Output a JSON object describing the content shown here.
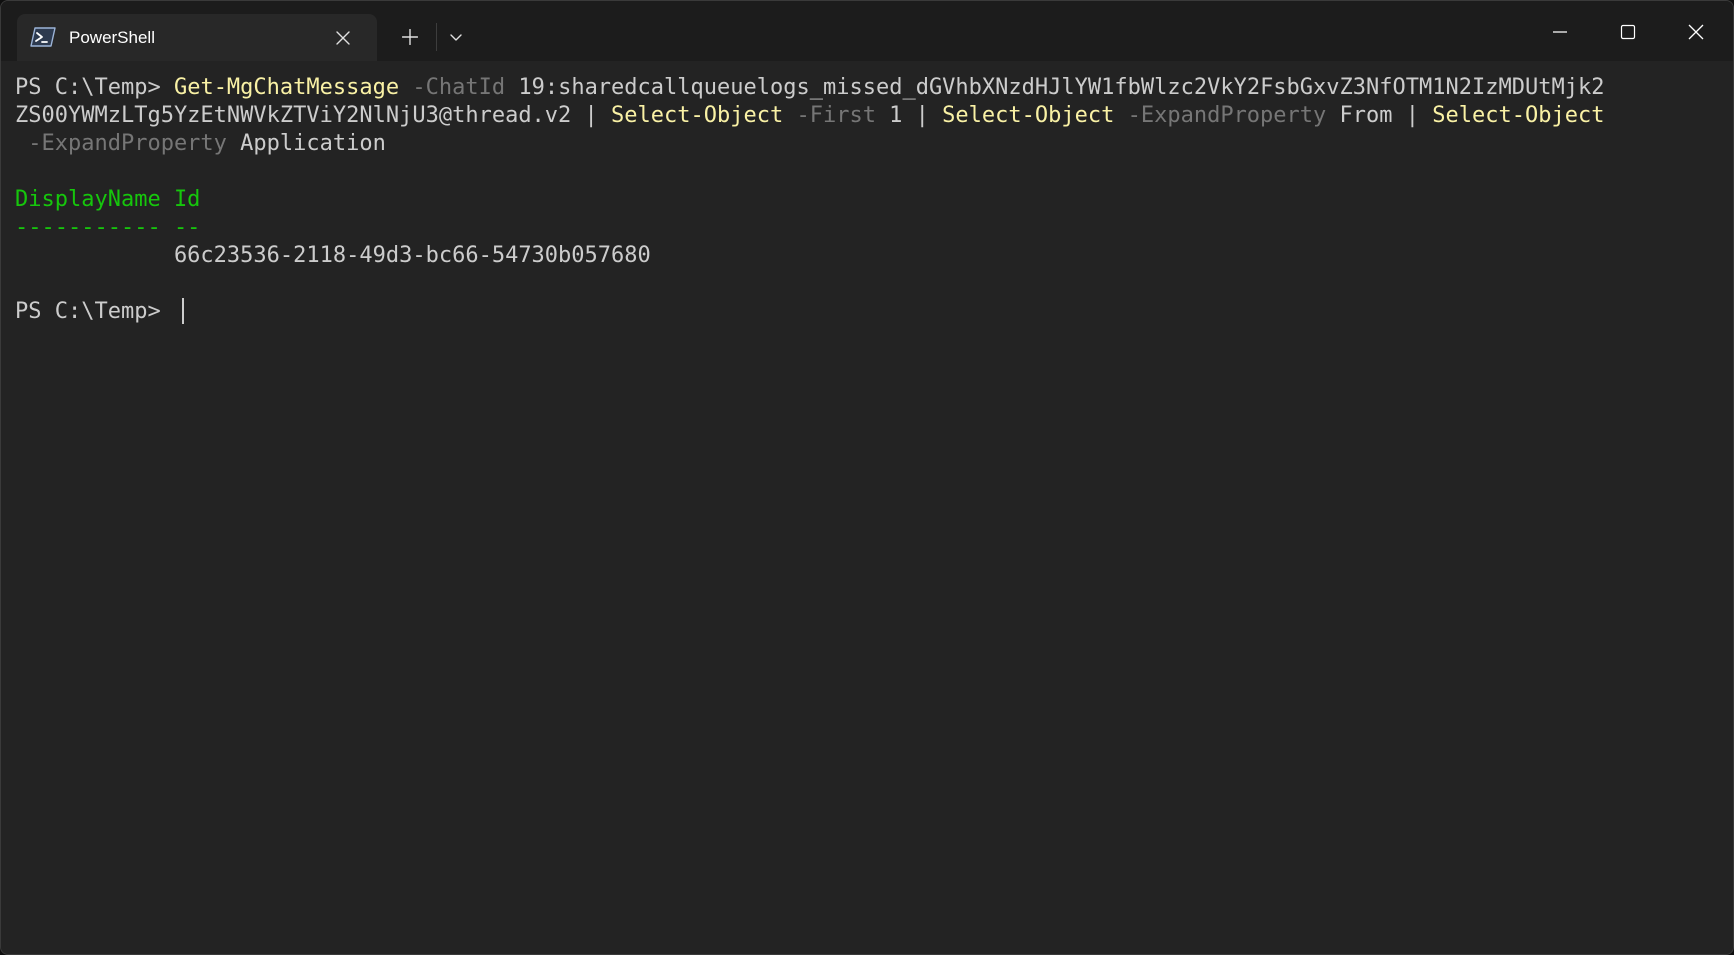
{
  "tab": {
    "title": "PowerShell",
    "icon": "powershell-icon"
  },
  "colors": {
    "command": "#f9f1a5",
    "parameter": "#767676",
    "text": "#cccccc",
    "table_header": "#16c60c",
    "background": "#232323"
  },
  "terminal": {
    "line1": {
      "prompt": "PS C:\\Temp> ",
      "cmd1": "Get-MgChatMessage",
      "p1": " -ChatId",
      "a1": " 19:sharedcallqueuelogs_missed_dGVhbXNzdHJlYW1fbWlzc2VkY2FsbGxvZ3NfOTM1N2IzMDUtMjk2"
    },
    "line2": {
      "a1": "ZS00YWMzLTg5YzEtNWVkZTViY2NlNjU3@thread.v2 | ",
      "cmd2": "Select-Object",
      "p2": " -First",
      "a2": " 1 | ",
      "cmd3": "Select-Object",
      "p3": " -ExpandProperty",
      "a3": " From | ",
      "cmd4": "Select-Object"
    },
    "line3": {
      "p4": " -ExpandProperty",
      "a4": " Application"
    },
    "table": {
      "header": "DisplayName Id",
      "separator": "----------- --",
      "row": "            66c23536-2118-49d3-bc66-54730b057680"
    },
    "prompt2": "PS C:\\Temp> "
  }
}
